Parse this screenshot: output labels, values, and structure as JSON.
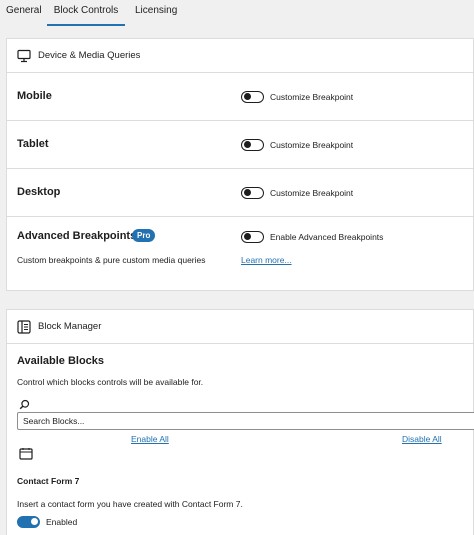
{
  "tabs": [
    {
      "label": "General"
    },
    {
      "label": "Block Controls"
    },
    {
      "label": "Licensing"
    }
  ],
  "device_section": {
    "title": "Device & Media Queries",
    "icon": "desktop-icon",
    "rows": [
      {
        "title": "Mobile",
        "toggle_label": "Customize Breakpoint",
        "enabled": false
      },
      {
        "title": "Tablet",
        "toggle_label": "Customize Breakpoint",
        "enabled": false
      },
      {
        "title": "Desktop",
        "toggle_label": "Customize Breakpoint",
        "enabled": false
      }
    ],
    "advanced": {
      "title": "Advanced Breakpoints",
      "badge": "Pro",
      "toggle_label": "Enable Advanced Breakpoints",
      "enabled": false,
      "description": "Custom breakpoints & pure custom media queries",
      "link": "Learn more..."
    }
  },
  "block_manager": {
    "title": "Block Manager",
    "icon": "block-manager-icon",
    "available_title": "Available Blocks",
    "available_desc": "Control which blocks controls will be available for.",
    "search_placeholder": "Search Blocks...",
    "enable_all": "Enable All",
    "disable_all": "Disable All",
    "block": {
      "icon": "block-icon",
      "name": "Contact Form 7",
      "description": "Insert a contact form you have created with Contact Form 7.",
      "status": "Enabled",
      "enabled": true
    }
  },
  "colors": {
    "accent": "#2271b1",
    "border": "#dcdcde",
    "background": "#f0f0f1"
  }
}
